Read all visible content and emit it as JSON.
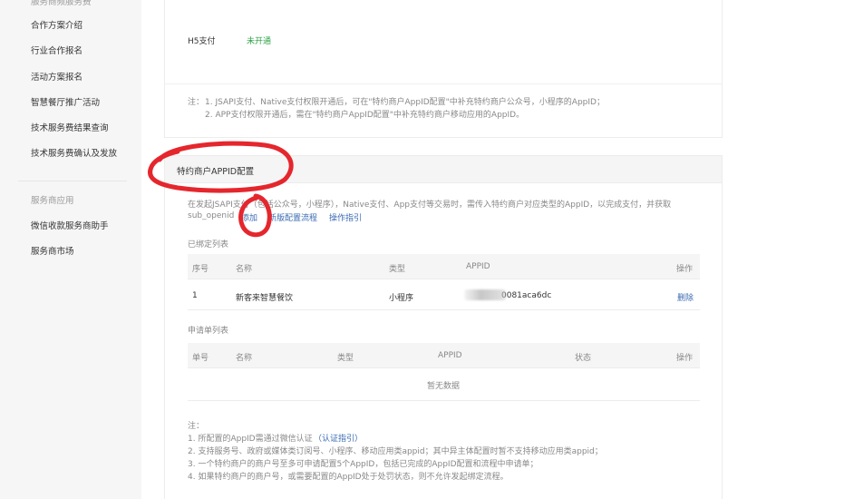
{
  "sidebar": {
    "cut_item": "服务商频服务费",
    "items": [
      "合作方案介绍",
      "行业合作报名",
      "活动方案报名",
      "智慧餐厅推广活动",
      "技术服务费结果查询",
      "技术服务费确认及发放"
    ],
    "heading": "服务商应用",
    "apps": [
      "微信收款服务商助手",
      "服务商市场"
    ]
  },
  "h5": {
    "label": "H5支付",
    "status": "未开通"
  },
  "notes_top": {
    "prefix": "注：",
    "line1": "1. JSAPI支付、Native支付权限开通后，可在\"特约商户AppID配置\"中补充特约商户公众号，小程序的AppID；",
    "line2": "2. APP支付权限开通后，需在\"特约商户AppID配置\"中补充特约商户移动应用的AppID。"
  },
  "appid_section": {
    "title": "特约商户APPID配置",
    "desc1": "在发起JSAPI支付（包括公众号，小程序），Native支付、App支付等交易时，需传入特约商户对应类型的AppID，以完成支付，并获取",
    "desc2": "sub_openid",
    "add_link": "添加",
    "flow_link": "新版配置流程",
    "guide_link": "操作指引"
  },
  "bound_list": {
    "title": "已绑定列表",
    "headers": {
      "seq": "序号",
      "name": "名称",
      "type": "类型",
      "appid": "APPID",
      "action": "操作"
    },
    "rows": [
      {
        "seq": "1",
        "name": "新客来智慧餐饮",
        "type": "小程序",
        "appid": "0081aca6dc",
        "action": "删除"
      }
    ]
  },
  "apply_list": {
    "title": "申请单列表",
    "headers": {
      "no": "单号",
      "name": "名称",
      "type": "类型",
      "appid": "APPID",
      "status": "状态",
      "action": "操作"
    },
    "empty": "暂无数据"
  },
  "notes_bottom": {
    "prefix": "注：",
    "line1": "1. 所配置的AppID需通过微信认证",
    "line1_link": "（认证指引）",
    "line2": "2. 支持服务号、政府或媒体类订阅号、小程序、移动应用类appid；其中异主体配置时暂不支持移动应用类appid；",
    "line3": "3. 一个特约商户的商户号至多可申请配置5个AppID，包括已完成的AppID配置和流程中申请单；",
    "line4": "4. 如果特约商户的商户号，或需要配置的AppID处于处罚状态，则不允许发起绑定流程。"
  },
  "colors": {
    "annotation": "#e5262d",
    "link": "#3b6bb3",
    "status_green": "#2ba245"
  }
}
